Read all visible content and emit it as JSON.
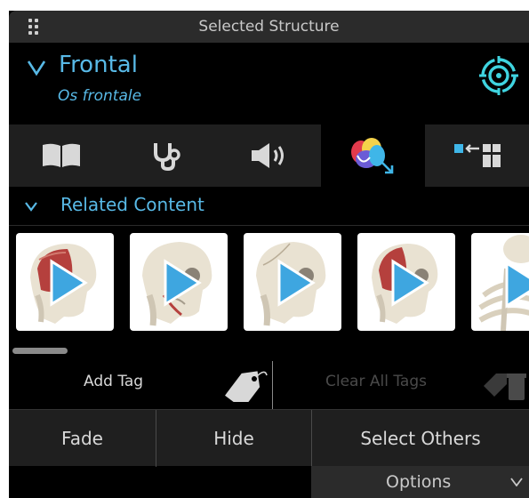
{
  "window": {
    "title": "Selected Structure"
  },
  "structure": {
    "name": "Frontal",
    "latin_name": "Os frontale"
  },
  "tabs": [
    {
      "icon": "book-icon",
      "active": false
    },
    {
      "icon": "stethoscope-icon",
      "active": false
    },
    {
      "icon": "speaker-icon",
      "active": false
    },
    {
      "icon": "related-structures-icon",
      "active": true
    },
    {
      "icon": "layout-arrow-icon",
      "active": false
    }
  ],
  "related": {
    "label": "Related Content",
    "items": [
      {
        "icon": "play-icon",
        "variant": "muscle"
      },
      {
        "icon": "play-icon",
        "variant": "skull"
      },
      {
        "icon": "play-icon",
        "variant": "skull"
      },
      {
        "icon": "play-icon",
        "variant": "muscle"
      },
      {
        "icon": "play-icon",
        "variant": "skeleton"
      }
    ]
  },
  "tags": {
    "add_label": "Add Tag",
    "clear_label": "Clear All Tags"
  },
  "actions": {
    "fade_label": "Fade",
    "hide_label": "Hide",
    "select_others_label": "Select Others"
  },
  "options": {
    "label": "Options"
  },
  "colors": {
    "accent": "#58b9e6",
    "panel": "#000000",
    "bar": "#2b2b2b",
    "button_bg": "#1f1f1f"
  }
}
